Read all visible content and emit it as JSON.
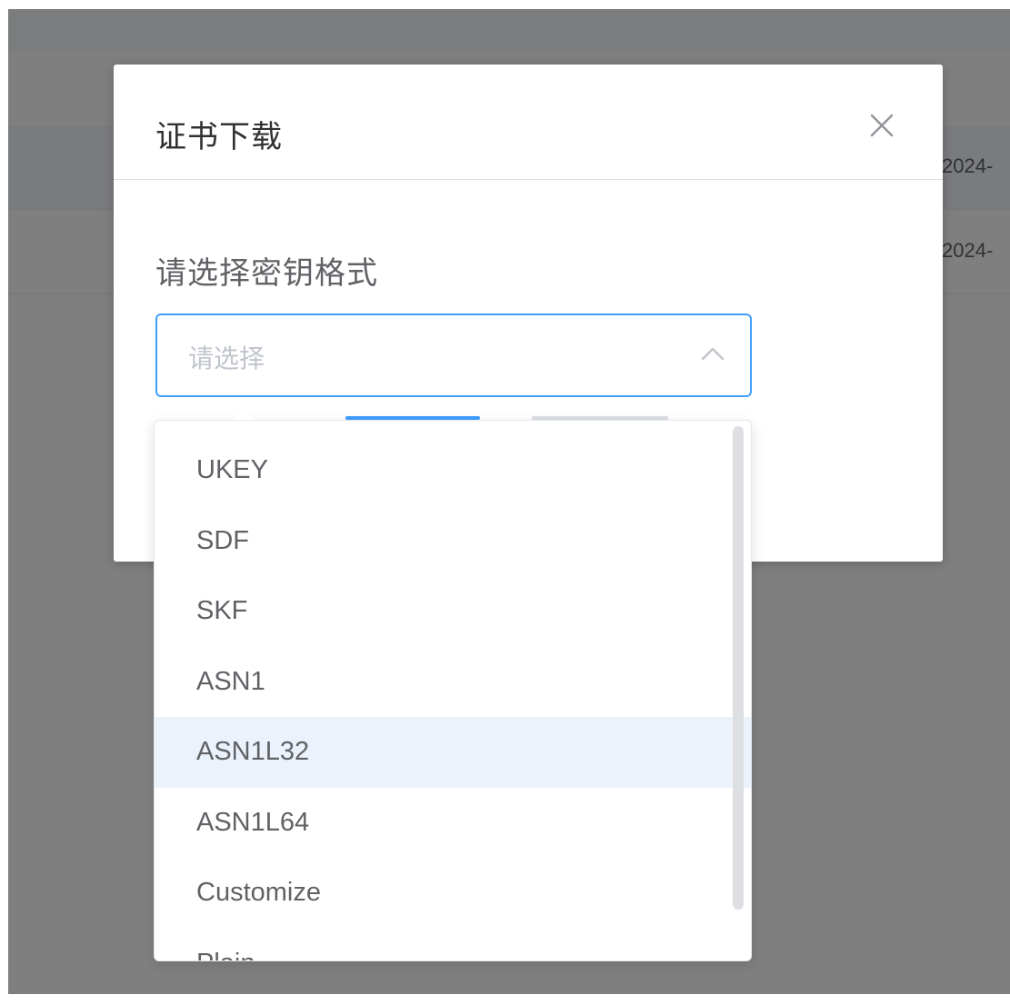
{
  "background": {
    "rows": [
      {
        "date_fragment": "2024-"
      },
      {
        "date_fragment": "2024-"
      }
    ]
  },
  "dialog": {
    "title": "证书下载",
    "close_icon": "close-icon",
    "form_label": "请选择密钥格式",
    "select": {
      "placeholder": "请选择",
      "arrow_icon": "chevron-up-icon",
      "open": true
    }
  },
  "dropdown": {
    "options": [
      {
        "label": "UKEY"
      },
      {
        "label": "SDF"
      },
      {
        "label": "SKF"
      },
      {
        "label": "ASN1"
      },
      {
        "label": "ASN1L32",
        "hovered": true
      },
      {
        "label": "ASN1L64"
      },
      {
        "label": "Customize"
      },
      {
        "label": "Plain"
      }
    ]
  },
  "colors": {
    "accent": "#409eff",
    "hover_bg": "#ecf2fb",
    "mask": "rgba(0,0,0,0.5)"
  }
}
